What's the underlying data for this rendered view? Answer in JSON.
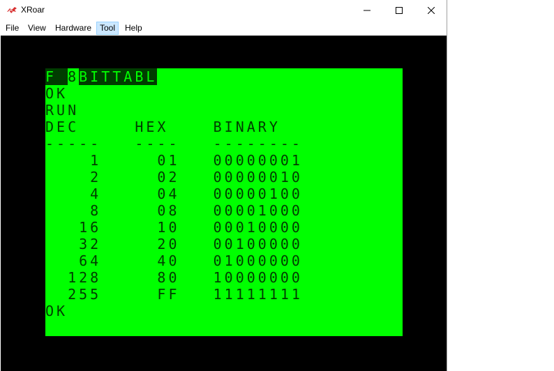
{
  "window": {
    "title": "XRoar"
  },
  "menu": {
    "items": [
      "File",
      "View",
      "Hardware",
      "Tool",
      "Help"
    ]
  },
  "screen": {
    "command_prefix": "F ",
    "command_mid": "8",
    "command_name": "BITTABL",
    "lines": [
      "OK",
      "RUN",
      "DEC     HEX    BINARY",
      "-----   ----   --------",
      "    1     01   00000001",
      "    2     02   00000010",
      "    4     04   00000100",
      "    8     08   00001000",
      "   16     10   00010000",
      "   32     20   00100000",
      "   64     40   01000000",
      "  128     80   10000000",
      "  255     FF   11111111",
      "OK"
    ]
  },
  "colors": {
    "screen_bg": "#00ff00",
    "screen_fg": "#003c00",
    "border": "#000000"
  }
}
